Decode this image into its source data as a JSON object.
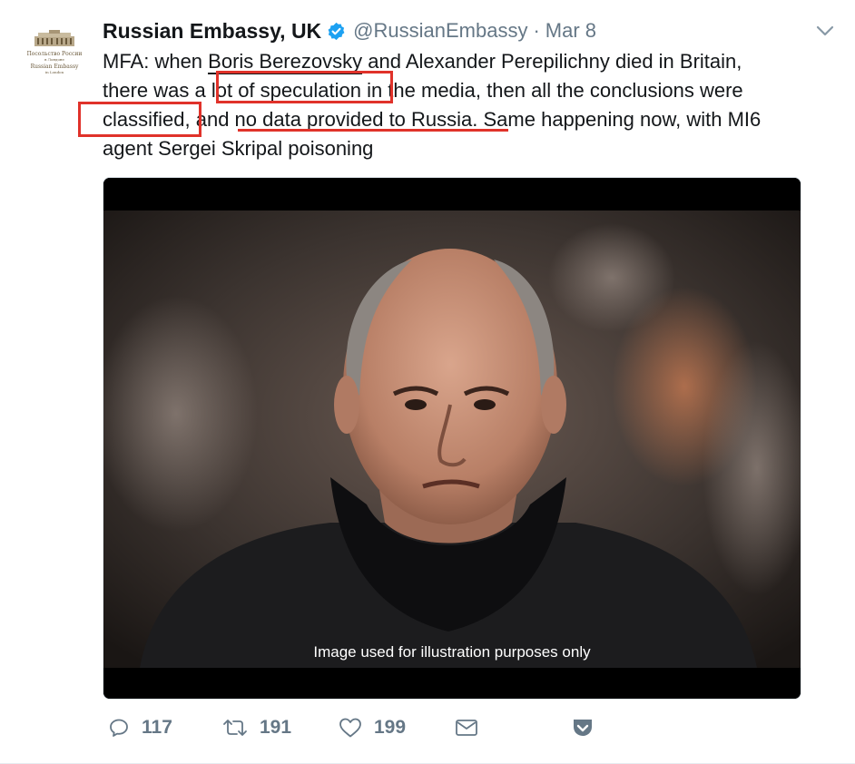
{
  "tweet": {
    "author_name": "Russian Embassy, UK",
    "handle": "@RussianEmbassy",
    "separator": "·",
    "date": "Mar 8",
    "text_segments": {
      "l1_a": "MFA: when ",
      "l1_b": "Boris Berezovsky",
      "l1_c": " and Alexander Perepilichny died in Britain,",
      "l2_a": "there was a ",
      "l2_b": "lot of speculation",
      "l2_c": " in the media, then all the conclusions were",
      "l3_a": "classified",
      "l3_b": ",",
      "l3_c": " and ",
      "l3_d": "no data provided to Russia",
      "l3_e": ". Same happening now, with MI6",
      "l4": "agent Sergei Skripal poisoning"
    },
    "media_caption": "Image used for illustration purposes only",
    "avatar_lines": [
      "Посольство России",
      "в Лондоне",
      "Russian Embassy",
      "in London"
    ],
    "counts": {
      "replies": "117",
      "retweets": "191",
      "likes": "199"
    }
  },
  "icons": {
    "verified": "verified-badge-icon",
    "caret": "chevron-down-icon",
    "reply": "reply-icon",
    "retweet": "retweet-icon",
    "like": "heart-icon",
    "dm": "envelope-icon",
    "save": "pocket-save-icon"
  },
  "colors": {
    "text": "#14171a",
    "secondary": "#657786",
    "verified_blue": "#1da1f2",
    "annotation_red": "#e0322a"
  }
}
